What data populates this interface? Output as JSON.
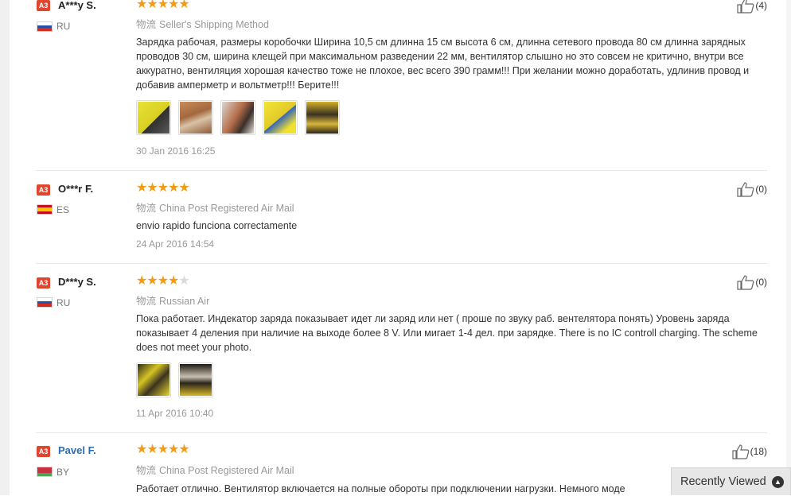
{
  "reviews": [
    {
      "user": "A***y S.",
      "badge": "A3",
      "country": "RU",
      "rating": 5,
      "shipping_label": "物流",
      "shipping": "Seller's Shipping Method",
      "text": "Зарядка рабочая, размеры коробочки Ширина 10,5 см длинна 15 см высота 6 см, длинна сетевого провода 80 см длинна зарядных проводов 30 см, ширина клещей при максимальном разведении 22 мм, вентилятор слышно но это совсем не критично, внутри все аккуратно, вентиляция хорошая качество тоже не плохое, вес всего 390 грамм!!! При желании можно доработать, удлинив провод и добавив амперметр и вольтметр!!! Берите!!!",
      "photos": 5,
      "date": "30 Jan 2016 16:25",
      "helpful": "(4)"
    },
    {
      "user": "O***r F.",
      "badge": "A3",
      "country": "ES",
      "rating": 5,
      "shipping_label": "物流",
      "shipping": "China Post Registered Air Mail",
      "text": "envio rapido funciona correctamente",
      "photos": 0,
      "date": "24 Apr 2016 14:54",
      "helpful": "(0)"
    },
    {
      "user": "D***y S.",
      "badge": "A3",
      "country": "RU",
      "rating": 4,
      "shipping_label": "物流",
      "shipping": "Russian Air",
      "text": "Пока работает. Индекатор заряда показывает идет ли заряд или нет ( проше по звуку раб. вентелятора понять) Уровень заряда показывает 4 деления при наличие на выходе более 8 V. Или мигает 1-4 дел. при зарядке. There is no IC controll charging. The scheme does not meet your photo.",
      "photos": 2,
      "date": "11 Apr 2016 10:40",
      "helpful": "(0)"
    },
    {
      "user": "Pavel F.",
      "badge": "A3",
      "country": "BY",
      "rating": 5,
      "shipping_label": "物流",
      "shipping": "China Post Registered Air Mail",
      "text": "Работает отлично. Вентилятор включается на полные обороты при подключении нагрузки. Немного моде",
      "photos": 0,
      "date": "",
      "helpful": "(18)"
    }
  ],
  "recently_viewed": {
    "label": "Recently Viewed",
    "icon": "chevron-up-icon"
  },
  "colors": {
    "star": "#f39c12",
    "badge": "#e0452f",
    "link": "#2b6cb0"
  }
}
